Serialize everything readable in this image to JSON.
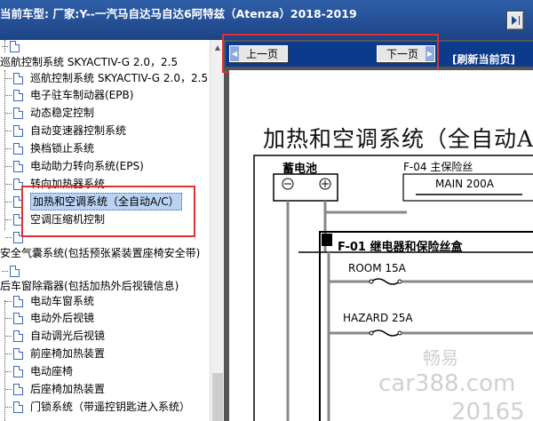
{
  "header": {
    "title": "当前车型:   厂家:Y--一汽马自达马自达6阿特兹（Atenza）2018-2019"
  },
  "tree": {
    "group_cruise": "巡航控制系统 SKYACTIV-G 2.0，2.5",
    "items_a": [
      "巡航控制系统 SKYACTIV-G 2.0，2.5",
      "电子驻车制动器(EPB)",
      "动态稳定控制",
      "自动变速器控制系统",
      "换档锁止系统",
      "电动助力转向系统(EPS)",
      "转向加热器系统",
      "加热和空调系统（全自动A/C）",
      "空调压缩机控制"
    ],
    "group_airbag": "安全气囊系统(包括预张紧装置座椅安全带)",
    "group_defrost": "后车窗除霜器(包括加热外后视镜信息)",
    "items_b": [
      "电动车窗系统",
      "电动外后视镜",
      "自动调光后视镜",
      "前座椅加热装置",
      "电动座椅",
      "后座椅加热装置",
      "门锁系统（带遥控钥匙进入系统）"
    ]
  },
  "nav": {
    "prev": "上一页",
    "next": "下一页",
    "refresh": "[刷新当前页]"
  },
  "document": {
    "title": "加热和空调系统（全自动A/C）",
    "battery": "蓄电池",
    "main_fuse_label": "F-04  主保险丝",
    "main_fuse_value": "MAIN 200A",
    "relay_box": "F-01  继电器和保险丝盒",
    "room_fuse": "ROOM 15A",
    "hazard_fuse": "HAZARD 25A",
    "watermark_brand": "畅易",
    "watermark_site": "car388.com",
    "watermark_code": "20165"
  }
}
